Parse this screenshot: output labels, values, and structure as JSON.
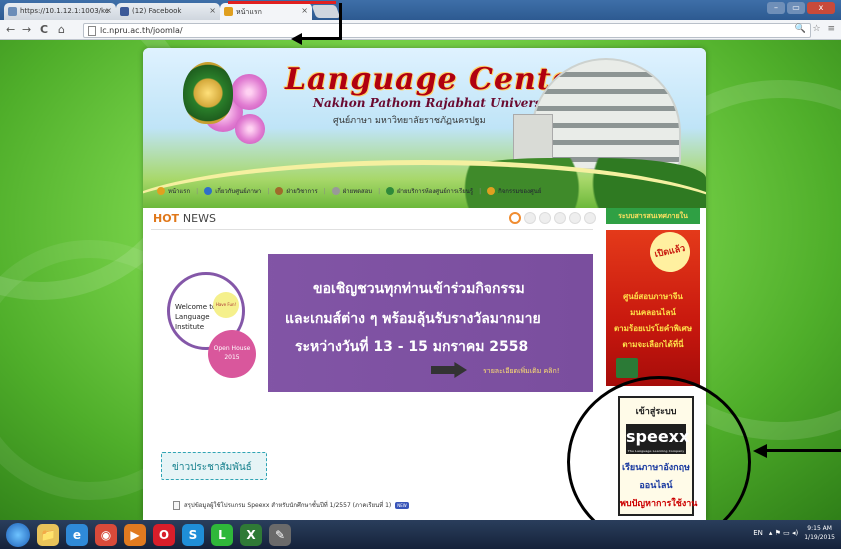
{
  "browser": {
    "tabs": [
      {
        "label": "https://10.1.12.1:1003/ke",
        "favicon_color": "#6b8db8",
        "active": false
      },
      {
        "label": "(12) Facebook",
        "favicon_color": "#3b5998",
        "active": false
      },
      {
        "label": "หน้าแรก",
        "favicon_color": "#e0a020",
        "active": true
      }
    ],
    "close_glyph": "×",
    "address": "lc.npru.ac.th/joomla/",
    "nav": {
      "back": "←",
      "forward": "→",
      "reload": "C",
      "home": "⌂"
    },
    "right_tools": "🔍 ☆ ≡",
    "window_buttons": {
      "minimize": "–",
      "maximize": "▭",
      "close": "x"
    }
  },
  "site": {
    "title": "Language Center",
    "subtitle": "Nakhon Pathom Rajabhat University",
    "thai_subtitle": "ศูนย์ภาษา มหาวิทยาลัยราชภัฏนครปฐม",
    "nav": [
      {
        "label": "หน้าแรก",
        "icon_color": "#e0a020"
      },
      {
        "label": "เกี่ยวกับศูนย์ภาษา",
        "icon_color": "#2f6fc8"
      },
      {
        "label": "ฝ่ายวิชาการ",
        "icon_color": "#a06a2a"
      },
      {
        "label": "ฝ่ายทดสอบ",
        "icon_color": "#999999"
      },
      {
        "label": "ฝ่ายบริการห้องศูนย์การเรียนรู้",
        "icon_color": "#2f8a3a"
      },
      {
        "label": "กิจกรรมของศูนย์",
        "icon_color": "#e0a020"
      }
    ],
    "nav_separator": "|",
    "hot_news": {
      "hot": "HOT",
      "news": "NEWS",
      "active_dot": 0,
      "dot_count": 6
    },
    "slide": {
      "welcome": "Welcome to Language Institute",
      "free_label": "Have Fun!",
      "open_house": "Open House 2015",
      "lines": [
        "ขอเชิญชวนทุกท่านเข้าร่วมกิจกรรม",
        "และเกมส์ต่าง ๆ พร้อมลุ้นรับรางวัลมากมาย",
        "ระหว่างวันที่ 13 - 15 มกราคม 2558"
      ],
      "more": "รายละเอียดเพิ่มเติม คลิก!"
    },
    "pr_tab": "ข่าวประชาสัมพันธ์",
    "news_items": [
      {
        "text": "สรุปข้อมูลผู้ใช้โปรแกรม Speexx สำหรับนักศึกษาชั้นปีที่ 1/2557 (ภาคเรียนที่ 1)",
        "badge": "NEW"
      }
    ],
    "right_column": {
      "header": "ระบบสารสนเทศภายใน",
      "promo_badge": "เปิดแล้ว",
      "promo_lines": [
        "ศูนย์สอบภาษาจีน",
        "มนคลอนไลน์",
        "ตามร้อยเปรโยคำพิเศษ",
        "ตามจะเลือกได้ที่นี่"
      ],
      "speexx": {
        "enter": "เข้าสู่ระบบ",
        "logo": "speexx",
        "logo_tagline": "The Language Learning Company",
        "line1": "เรียนภาษาอังกฤษ",
        "line2": "ออนไลน์",
        "line3": "พบปัญหาการใช้งาน"
      }
    }
  },
  "taskbar": {
    "apps": [
      {
        "name": "explorer-icon",
        "glyph": "📁",
        "color": "#e8c35a"
      },
      {
        "name": "ie-icon",
        "glyph": "e",
        "color": "#2f8ad8"
      },
      {
        "name": "chrome-icon",
        "glyph": "◉",
        "color": "#d84a3a"
      },
      {
        "name": "media-icon",
        "glyph": "▶",
        "color": "#e07a20"
      },
      {
        "name": "opera-icon",
        "glyph": "O",
        "color": "#d81e2a"
      },
      {
        "name": "skype-icon",
        "glyph": "S",
        "color": "#1f8ed8"
      },
      {
        "name": "line-icon",
        "glyph": "L",
        "color": "#2fb83a"
      },
      {
        "name": "excel-icon",
        "glyph": "X",
        "color": "#2f7a36"
      },
      {
        "name": "paint-icon",
        "glyph": "✎",
        "color": "#6a6a6a"
      }
    ],
    "tray_lang": "EN",
    "tray_icons": "▴ ⚑ ▭ ◂)",
    "time": "9:15 AM",
    "date": "1/19/2015"
  }
}
